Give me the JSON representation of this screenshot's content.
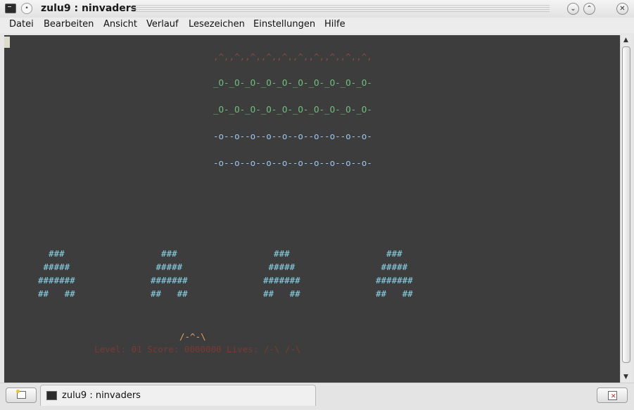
{
  "window": {
    "title": "zulu9 : ninvaders",
    "sticky_symbol": "•",
    "minimize_symbol": "⌄",
    "maximize_symbol": "⌃",
    "close_symbol": "✕"
  },
  "menu": [
    "Datei",
    "Bearbeiten",
    "Ansicht",
    "Verlauf",
    "Lesezeichen",
    "Einstellungen",
    "Hilfe"
  ],
  "terminal": {
    "background": "#3d3d3d",
    "invaders": [
      {
        "text": ",^,,^,,^,,^,,^,,^,,^,,^,,^,,^,",
        "color": "#8a4a44"
      },
      {
        "text": "_O-_O-_O-_O-_O-_O-_O-_O-_O-_O-",
        "color": "#6fbf7f"
      },
      {
        "text": "_O-_O-_O-_O-_O-_O-_O-_O-_O-_O-",
        "color": "#6fbf7f"
      },
      {
        "text": "-o--o--o--o--o--o--o--o--o--o-",
        "color": "#9dc7ee"
      },
      {
        "text": "-o--o--o--o--o--o--o--o--o--o-",
        "color": "#9dc7ee"
      }
    ],
    "bunker_lines": [
      "  ###",
      " #####",
      "#######",
      "##   ##"
    ],
    "bunker_color": "#8ad8ee",
    "player": "/-^-\\",
    "player_color": "#e6a060",
    "status": "Level: 01 Score: 0000000 Lives: /-\\ /-\\",
    "status_color": "#7a3a34"
  },
  "tabbar": {
    "tab_label": "zulu9 : ninvaders",
    "new_tab_icon": "new-tab-icon",
    "close_tab_icon": "close-tab-icon"
  }
}
